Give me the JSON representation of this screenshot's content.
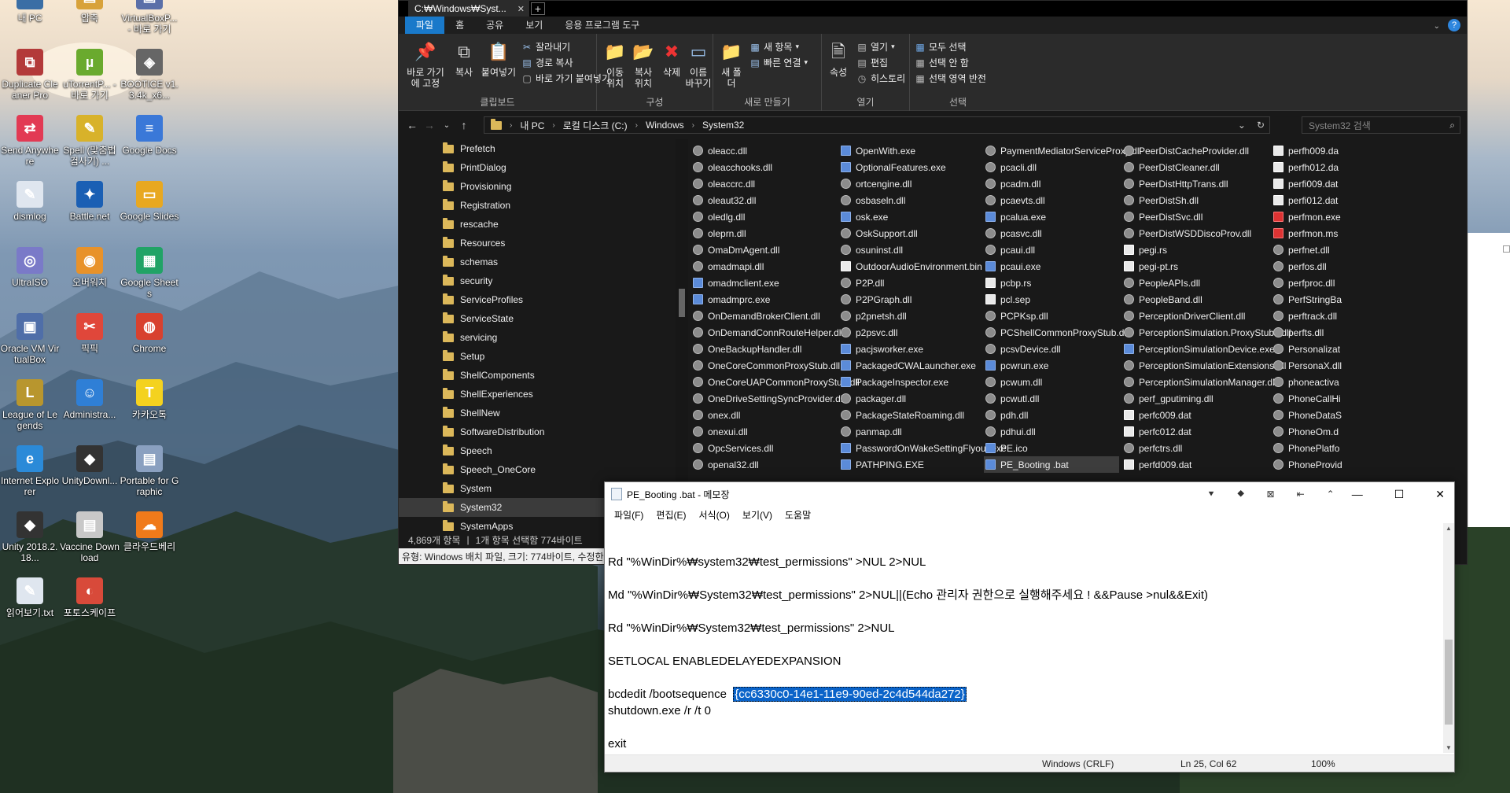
{
  "desktop": {
    "icons": [
      {
        "label": "내 PC",
        "color": "#3a6ea5",
        "glyph": "▭"
      },
      {
        "label": "압축",
        "color": "#d8a23a",
        "glyph": "▤"
      },
      {
        "label": "VirtualBoxP... - 바로 가기",
        "color": "#5a6fa8",
        "glyph": "▣"
      },
      {
        "label": "Duplicate Cleaner Pro",
        "color": "#b33a3a",
        "glyph": "⧉"
      },
      {
        "label": "uTorrentP... - 바로 가기",
        "color": "#6aaa2e",
        "glyph": "µ"
      },
      {
        "label": "BOOTICE v1.3.4k_x6...",
        "color": "#666666",
        "glyph": "◈"
      },
      {
        "label": "Send Anywhere",
        "color": "#e23a54",
        "glyph": "⇄"
      },
      {
        "label": "Spell (맞춤법 검사기) ...",
        "color": "#d8b22a",
        "glyph": "✎"
      },
      {
        "label": "Google Docs",
        "color": "#3a78d8",
        "glyph": "≡"
      },
      {
        "label": "dismlog",
        "color": "#dfe6ef",
        "glyph": "✎"
      },
      {
        "label": "Battle.net",
        "color": "#1a5fb4",
        "glyph": "✦"
      },
      {
        "label": "Google Slides",
        "color": "#e8a820",
        "glyph": "▭"
      },
      {
        "label": "UltraISO",
        "color": "#7a7ac8",
        "glyph": "◎"
      },
      {
        "label": "오버워치",
        "color": "#e8922a",
        "glyph": "◉"
      },
      {
        "label": "Google Sheets",
        "color": "#21a366",
        "glyph": "▦"
      },
      {
        "label": "Oracle VM VirtualBox",
        "color": "#4f6ea8",
        "glyph": "▣"
      },
      {
        "label": "픽픽",
        "color": "#e0473a",
        "glyph": "✂"
      },
      {
        "label": "Chrome",
        "color": "#d8412f",
        "glyph": "◍"
      },
      {
        "label": "League of Legends",
        "color": "#b8962e",
        "glyph": "L"
      },
      {
        "label": "Administra...",
        "color": "#2f7fd6",
        "glyph": "☺"
      },
      {
        "label": "카카오톡",
        "color": "#f4d21f",
        "glyph": "T"
      },
      {
        "label": "Internet Explorer",
        "color": "#2b8ad8",
        "glyph": "e"
      },
      {
        "label": "UnityDownl...",
        "color": "#333333",
        "glyph": "◆"
      },
      {
        "label": "Portable for Graphic",
        "color": "#8aa0c0",
        "glyph": "▤"
      },
      {
        "label": "Unity 2018.2.18...",
        "color": "#333333",
        "glyph": "◆"
      },
      {
        "label": "Vaccine Download",
        "color": "#c8c8c8",
        "glyph": "▤"
      },
      {
        "label": "클라우드베리",
        "color": "#f07a1a",
        "glyph": "☁"
      },
      {
        "label": "읽어보기.txt",
        "color": "#dfe6ef",
        "glyph": "✎"
      },
      {
        "label": "포토스케이프",
        "color": "#d84a3a",
        "glyph": "◐"
      }
    ]
  },
  "explorer": {
    "tab_title": "C:₩Windows₩Syst...",
    "ribbon_tabs": [
      "파일",
      "홈",
      "공유",
      "보기",
      "응용 프로그램 도구"
    ],
    "ribbon": {
      "clipboard": {
        "pin": "바로 가기에 고정",
        "copy": "복사",
        "paste": "붙여넣기",
        "cut": "잘라내기",
        "copy_path": "경로 복사",
        "paste_shortcut": "바로 가기 붙여넣기",
        "label": "클립보드"
      },
      "organize": {
        "move_to": "이동 위치",
        "copy_to": "복사 위치",
        "delete": "삭제",
        "rename": "이름 바꾸기",
        "label": "구성"
      },
      "new": {
        "new_folder": "새 폴더",
        "new_item": "새 항목",
        "easy_access": "빠른 연결",
        "label": "새로 만들기"
      },
      "open": {
        "properties": "속성",
        "open": "열기",
        "edit": "편집",
        "history": "히스토리",
        "label": "열기"
      },
      "select": {
        "select_all": "모두 선택",
        "select_none": "선택 안 함",
        "invert": "선택 영역 반전",
        "label": "선택"
      }
    },
    "address": {
      "parts": [
        "내 PC",
        "로컬 디스크 (C:)",
        "Windows",
        "System32"
      ],
      "search_placeholder": "System32 검색"
    },
    "nav_items": [
      "Prefetch",
      "PrintDialog",
      "Provisioning",
      "Registration",
      "rescache",
      "Resources",
      "schemas",
      "security",
      "ServiceProfiles",
      "ServiceState",
      "servicing",
      "Setup",
      "ShellComponents",
      "ShellExperiences",
      "ShellNew",
      "SoftwareDistribution",
      "Speech",
      "Speech_OneCore",
      "System",
      "System32",
      "SystemApps"
    ],
    "nav_selected": "System32",
    "file_columns": [
      [
        "oleacc.dll",
        "oleacchooks.dll",
        "oleaccrc.dll",
        "oleaut32.dll",
        "oledlg.dll",
        "oleprn.dll",
        "OmaDmAgent.dll",
        "omadmapi.dll",
        "omadmclient.exe",
        "omadmprc.exe",
        "OnDemandBrokerClient.dll",
        "OnDemandConnRouteHelper.dll",
        "OneBackupHandler.dll",
        "OneCoreCommonProxyStub.dll",
        "OneCoreUAPCommonProxyStub.dll",
        "OneDriveSettingSyncProvider.dll",
        "onex.dll",
        "onexui.dll",
        "OpcServices.dll",
        "openal32.dll"
      ],
      [
        "OpenWith.exe",
        "OptionalFeatures.exe",
        "ortcengine.dll",
        "osbaseln.dll",
        "osk.exe",
        "OskSupport.dll",
        "osuninst.dll",
        "OutdoorAudioEnvironment.bin",
        "P2P.dll",
        "P2PGraph.dll",
        "p2pnetsh.dll",
        "p2psvc.dll",
        "pacjsworker.exe",
        "PackagedCWALauncher.exe",
        "PackageInspector.exe",
        "packager.dll",
        "PackageStateRoaming.dll",
        "panmap.dll",
        "PasswordOnWakeSettingFlyout.exe",
        "PATHPING.EXE"
      ],
      [
        "PaymentMediatorServiceProxy.dll",
        "pcacli.dll",
        "pcadm.dll",
        "pcaevts.dll",
        "pcalua.exe",
        "pcasvc.dll",
        "pcaui.dll",
        "pcaui.exe",
        "pcbp.rs",
        "pcl.sep",
        "PCPKsp.dll",
        "PCShellCommonProxyStub.dll",
        "pcsvDevice.dll",
        "pcwrun.exe",
        "pcwum.dll",
        "pcwutl.dll",
        "pdh.dll",
        "pdhui.dll",
        "PE.ico",
        "PE_Booting .bat"
      ],
      [
        "PeerDistCacheProvider.dll",
        "PeerDistCleaner.dll",
        "PeerDistHttpTrans.dll",
        "PeerDistSh.dll",
        "PeerDistSvc.dll",
        "PeerDistWSDDiscoProv.dll",
        "pegi.rs",
        "pegi-pt.rs",
        "PeopleAPIs.dll",
        "PeopleBand.dll",
        "PerceptionDriverClient.dll",
        "PerceptionSimulation.ProxyStubs.dll",
        "PerceptionSimulationDevice.exe",
        "PerceptionSimulationExtensions.dll",
        "PerceptionSimulationManager.dll",
        "perf_gputiming.dll",
        "perfc009.dat",
        "perfc012.dat",
        "perfctrs.dll",
        "perfd009.dat"
      ],
      [
        "perfh009.da",
        "perfh012.da",
        "perfi009.dat",
        "perfi012.dat",
        "perfmon.exe",
        "perfmon.ms",
        "perfnet.dll",
        "perfos.dll",
        "perfproc.dll",
        "PerfStringBa",
        "perftrack.dll",
        "perfts.dll",
        "Personalizat",
        "PersonaX.dll",
        "phoneactiva",
        "PhoneCallHi",
        "PhoneDataS",
        "PhoneOm.d",
        "PhonePlatfo",
        "PhoneProvid"
      ]
    ],
    "selected_file": "PE_Booting .bat",
    "status": {
      "count": "4,869개 항목",
      "selection": "1개 항목 선택함 774바이트"
    },
    "info": "유형: Windows 배치 파일, 크기: 774바이트, 수정한"
  },
  "notepad": {
    "title": "PE_Booting .bat - 메모장",
    "toolbar_glyphs": [
      "⯆",
      "⯁",
      "⊠",
      "⇤",
      "⌃"
    ],
    "menu": [
      "파일(F)",
      "편집(E)",
      "서식(O)",
      "보기(V)",
      "도움말"
    ],
    "lines": {
      "l1": "Rd \"%WinDir%₩system32₩test_permissions\" >NUL 2>NUL",
      "l2": "Md \"%WinDir%₩System32₩test_permissions\" 2>NUL||(Echo 관리자 권한으로 실행해주세요 ! &&Pause >nul&&Exit)",
      "l3": "Rd \"%WinDir%₩System32₩test_permissions\" 2>NUL",
      "l4": "SETLOCAL ENABLEDELAYEDEXPANSION",
      "l5_prefix": "bcdedit /bootsequence  ",
      "l5_selected": "{cc6330c0-14e1-11e9-90ed-2c4d544da272}",
      "l6": "shutdown.exe /r /t 0",
      "l7": "exit"
    },
    "status": {
      "encoding": "Windows (CRLF)",
      "position": "Ln 25, Col 62",
      "zoom": "100%"
    }
  }
}
